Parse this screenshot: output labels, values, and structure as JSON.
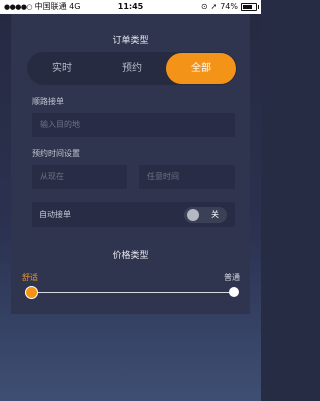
{
  "status_bar": {
    "signal": "●●●●○",
    "carrier": "中国联通",
    "network": "4G",
    "time": "11:45",
    "lock_icon": "orientation-lock-icon",
    "location_icon": "location-arrow-icon",
    "battery_percent": "74%",
    "battery_level": 0.74
  },
  "order_type": {
    "title": "订单类型",
    "options": [
      "实时",
      "预约",
      "全部"
    ],
    "selected": "全部"
  },
  "route_order": {
    "label": "顺路接单",
    "placeholder": "输入目的地"
  },
  "reservation_time": {
    "label": "预约时间设置",
    "start_placeholder": "从现在",
    "end_placeholder": "任意时间"
  },
  "auto_accept": {
    "label": "自动接单",
    "state_text": "关"
  },
  "price_type": {
    "title": "价格类型",
    "left_label": "舒适",
    "right_label": "普通",
    "selected": "舒适"
  },
  "colors": {
    "accent": "#f39419",
    "background": "#262c44",
    "panel": "#30354f",
    "field": "#282c44"
  }
}
